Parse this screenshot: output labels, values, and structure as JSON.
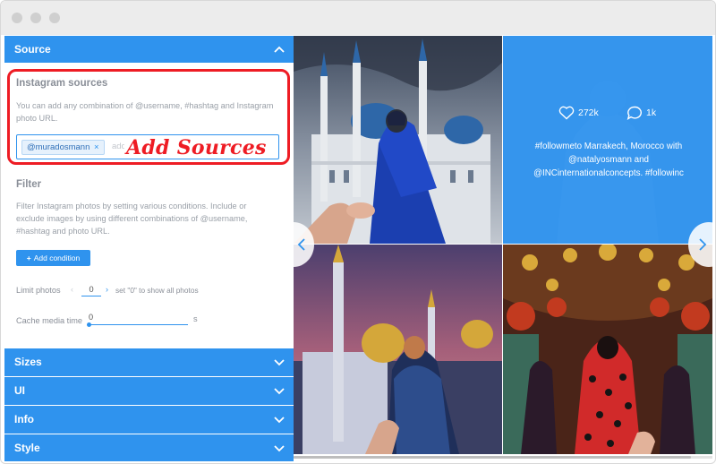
{
  "sidebar": {
    "source_section": {
      "title": "Source",
      "instagram_sources": {
        "title": "Instagram sources",
        "description": "You can add any combination of @username, #hashtag and Instagram photo URL.",
        "tag": "@muradosmann",
        "tag_remove": "×",
        "placeholder": "add..."
      },
      "annotation": "Add Sources",
      "filter": {
        "title": "Filter",
        "description": "Filter Instagram photos by setting various conditions. Include or exclude images by using different combinations of @username, #hashtag and photo URL.",
        "add_condition_label": "Add condition",
        "add_condition_icon": "+"
      },
      "limit_photos": {
        "label": "Limit photos",
        "value": "0",
        "hint": "set \"0\" to show all photos"
      },
      "cache_media_time": {
        "label": "Cache media time",
        "value": "0",
        "unit": "s"
      }
    },
    "collapsed_sections": [
      "Sizes",
      "UI",
      "Info",
      "Style"
    ]
  },
  "feed": {
    "hover_post": {
      "likes": "272k",
      "comments": "1k",
      "caption": "#followmeto Marrakech, Morocco with @natalyosmann and @INCinternationalconcepts. #followinc"
    },
    "icons": {
      "likes": "heart-icon",
      "comments": "comment-icon",
      "prev": "chevron-left-icon",
      "next": "chevron-right-icon"
    }
  },
  "colors": {
    "accent": "#2f93ee",
    "annotation": "#ee1c24"
  }
}
